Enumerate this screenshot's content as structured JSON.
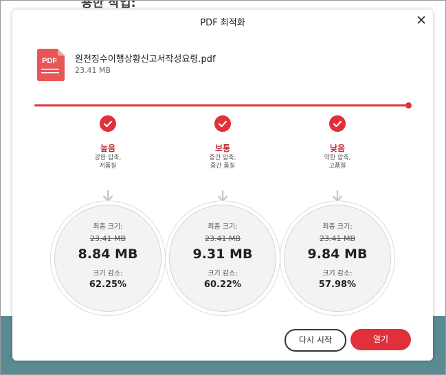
{
  "background": {
    "partial_text": "용한 작업:"
  },
  "dialog": {
    "title": "PDF 최적화",
    "file": {
      "icon_text": "PDF",
      "name": "원천징수이행상황신고서작성요령.pdf",
      "size": "23.41 MB"
    },
    "progress": 1.0,
    "options": [
      {
        "level": "높음",
        "desc_line1": "강한 압축,",
        "desc_line2": "저품질",
        "final_size_label": "최종 크기:",
        "original_size": "23.41 MB",
        "final_size": "8.84 MB",
        "reduction_label": "크기 감소:",
        "reduction": "62.25%"
      },
      {
        "level": "보통",
        "desc_line1": "중간 압축,",
        "desc_line2": "중간 품질",
        "final_size_label": "최종 크기:",
        "original_size": "23.41 MB",
        "final_size": "9.31 MB",
        "reduction_label": "크기 감소:",
        "reduction": "60.22%"
      },
      {
        "level": "낮음",
        "desc_line1": "약한 압축,",
        "desc_line2": "고품질",
        "final_size_label": "최종 크기:",
        "original_size": "23.41 MB",
        "final_size": "9.84 MB",
        "reduction_label": "크기 감소:",
        "reduction": "57.98%"
      }
    ],
    "buttons": {
      "restart": "다시 시작",
      "open": "열기"
    }
  },
  "colors": {
    "accent": "#e0313b",
    "level_text": "#c62a33",
    "circle_bg": "#f3f3f6",
    "background_bottom": "#5a8b93"
  },
  "icons": {
    "close": "close-icon",
    "check": "check-icon",
    "arrow": "arrow-down-icon",
    "file": "pdf-file-icon"
  }
}
